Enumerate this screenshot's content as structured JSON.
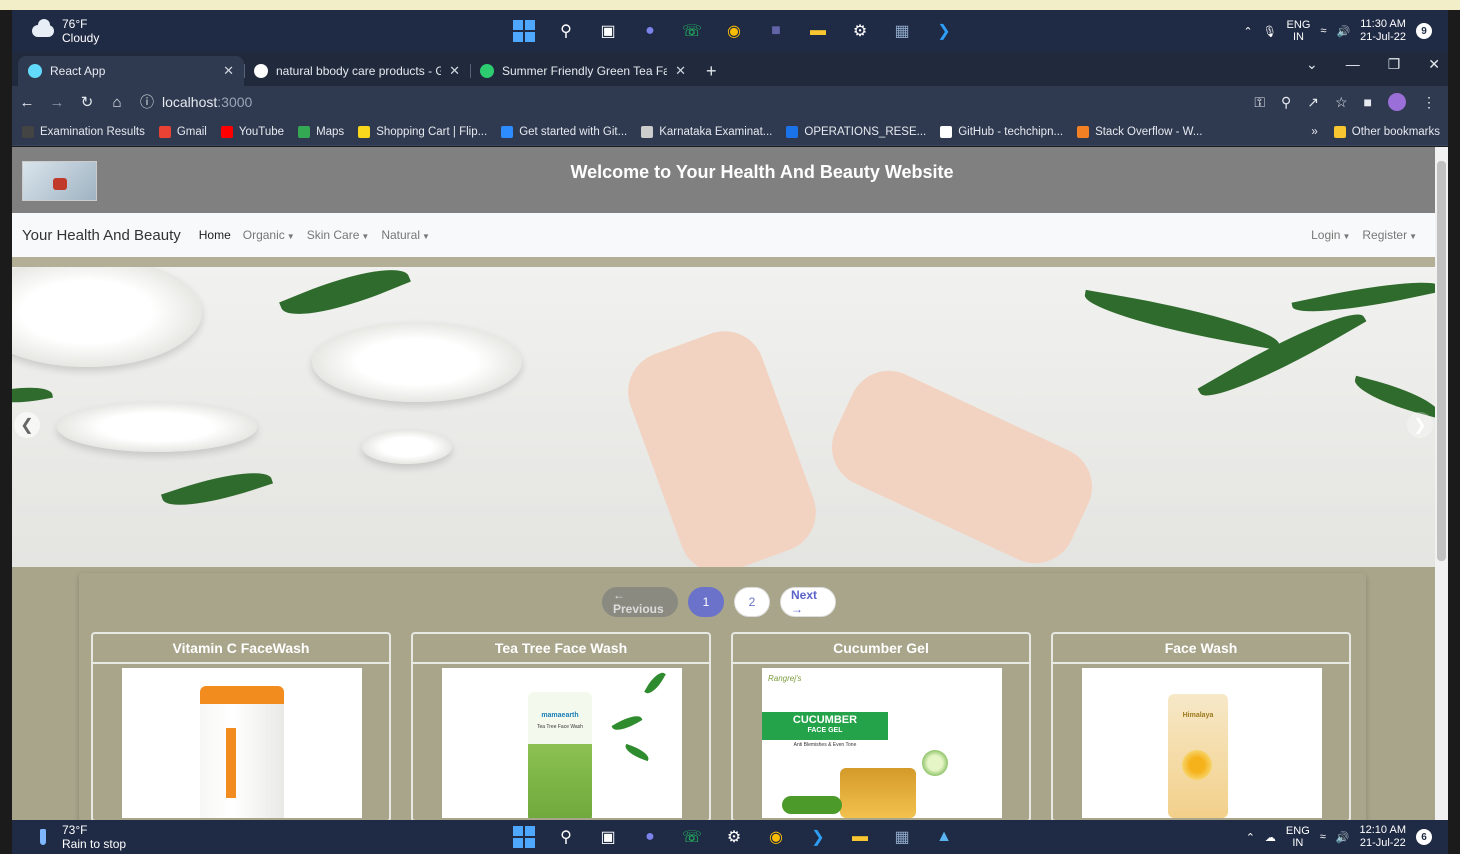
{
  "top_taskbar": {
    "weather_temp": "76°F",
    "weather_desc": "Cloudy",
    "lang": "ENG",
    "region": "IN",
    "time": "11:30 AM",
    "date": "21-Jul-22",
    "badge": "9"
  },
  "tabs": [
    {
      "title": "React App",
      "color": "#61dafb"
    },
    {
      "title": "natural bbody care products - Go",
      "color": "#ffffff"
    },
    {
      "title": "Summer Friendly Green Tea Face",
      "color": "#2ecc71"
    }
  ],
  "address": {
    "url_prefix": "localhost",
    "url_port": ":3000"
  },
  "bookmarks": [
    {
      "label": "Examination Results",
      "color": "#444"
    },
    {
      "label": "Gmail",
      "color": "#ea4335"
    },
    {
      "label": "YouTube",
      "color": "#ff0000"
    },
    {
      "label": "Maps",
      "color": "#34a853"
    },
    {
      "label": "Shopping Cart | Flip...",
      "color": "#f9d71c"
    },
    {
      "label": "Get started with Git...",
      "color": "#2d8cff"
    },
    {
      "label": "Karnataka Examinat...",
      "color": "#cccccc"
    },
    {
      "label": "OPERATIONS_RESE...",
      "color": "#1a73e8"
    },
    {
      "label": "GitHub - techchipn...",
      "color": "#ffffff"
    },
    {
      "label": "Stack Overflow - W...",
      "color": "#f48024"
    }
  ],
  "bookmarks_more": "»",
  "other_bookmarks": "Other bookmarks",
  "site": {
    "heading": "Welcome to Your Health And Beauty Website",
    "brand": "Your Health And Beauty",
    "nav": [
      "Home",
      "Organic",
      "Skin Care",
      "Natural"
    ],
    "nav_right": [
      "Login",
      "Register"
    ]
  },
  "pager": {
    "prev": "← Previous",
    "pages": [
      "1",
      "2"
    ],
    "next": "Next →"
  },
  "products": [
    {
      "title": "Vitamin C FaceWash"
    },
    {
      "title": "Tea Tree Face Wash"
    },
    {
      "title": "Cucumber Gel"
    },
    {
      "title": "Face Wash"
    }
  ],
  "product_labels": {
    "cucumber_brand": "Rangrej's",
    "cucumber_title": "CUCUMBER",
    "cucumber_sub": "FACE GEL",
    "cucumber_tag": "Anti Blemishes & Even Tone",
    "mamaearth": "mamaearth",
    "tea_tree": "Tea Tree Face Wash",
    "himalaya": "Himalaya"
  },
  "bottom_taskbar": {
    "weather_temp": "73°F",
    "weather_desc": "Rain to stop",
    "lang": "ENG",
    "region": "IN",
    "time": "12:10 AM",
    "date": "21-Jul-22",
    "badge": "6"
  }
}
